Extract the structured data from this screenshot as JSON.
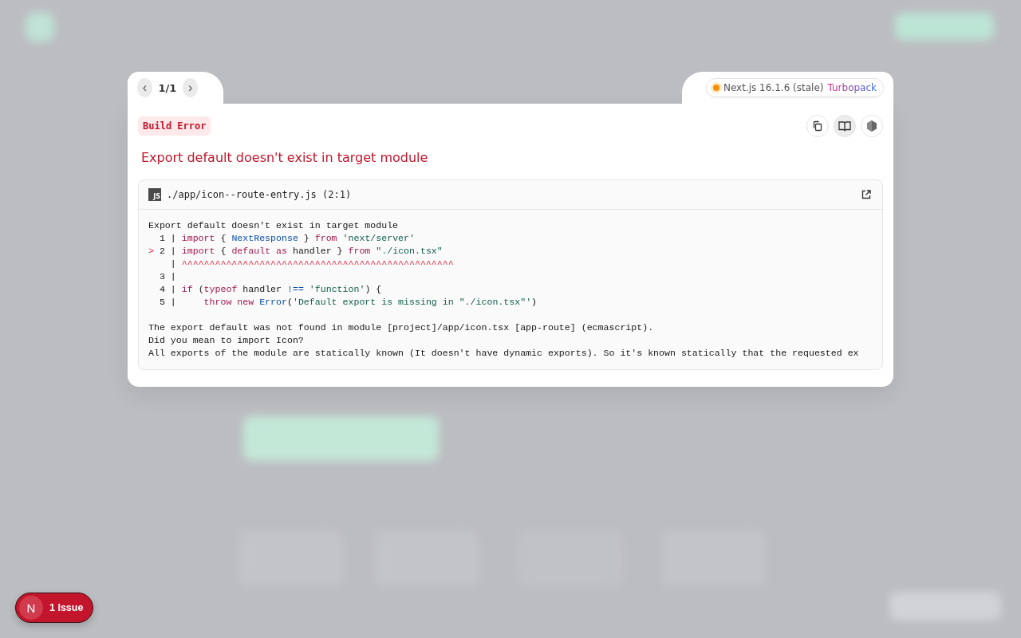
{
  "pager": {
    "prev": "‹",
    "count": "1/1",
    "next": "›"
  },
  "version": {
    "label": "Next.js 16.1.6 (stale)",
    "bundler": "Turbopack"
  },
  "error_type": "Build Error",
  "title": "Export default doesn't exist in target module",
  "file": {
    "badge": "JS",
    "path": "./app/icon--route-entry.js (2:1)"
  },
  "code_blocks": [
    [
      [
        {
          "kind": "plain",
          "text": "Export default doesn't exist in target module"
        }
      ],
      [
        {
          "kind": "plain",
          "text": "  1 | "
        },
        {
          "kind": "keyword",
          "text": "import"
        },
        {
          "kind": "plain",
          "text": " { "
        },
        {
          "kind": "ident",
          "text": "NextResponse"
        },
        {
          "kind": "plain",
          "text": " } "
        },
        {
          "kind": "keyword",
          "text": "from"
        },
        {
          "kind": "string",
          "text": " 'next/server'"
        }
      ],
      [
        {
          "kind": "marker",
          "text": ">"
        },
        {
          "kind": "plain",
          "text": " 2 | "
        },
        {
          "kind": "keyword",
          "text": "import"
        },
        {
          "kind": "plain",
          "text": " { "
        },
        {
          "kind": "keyword",
          "text": "default as"
        },
        {
          "kind": "plain",
          "text": " handler } "
        },
        {
          "kind": "keyword",
          "text": "from"
        },
        {
          "kind": "string",
          "text": " \"./icon.tsx\""
        }
      ],
      [
        {
          "kind": "plain",
          "text": "    | "
        },
        {
          "kind": "marker",
          "text": "^^^^^^^^^^^^^^^^^^^^^^^^^^^^^^^^^^^^^^^^^^^^^^^^^"
        }
      ],
      [
        {
          "kind": "plain",
          "text": "  3 |"
        }
      ],
      [
        {
          "kind": "plain",
          "text": "  4 | "
        },
        {
          "kind": "keyword",
          "text": "if"
        },
        {
          "kind": "plain",
          "text": " ("
        },
        {
          "kind": "keyword",
          "text": "typeof"
        },
        {
          "kind": "plain",
          "text": " handler "
        },
        {
          "kind": "ident",
          "text": "!=="
        },
        {
          "kind": "string",
          "text": " 'function'"
        },
        {
          "kind": "plain",
          "text": ") {"
        }
      ],
      [
        {
          "kind": "plain",
          "text": "  5 |     "
        },
        {
          "kind": "keyword",
          "text": "throw new"
        },
        {
          "kind": "ident",
          "text": " Error"
        },
        {
          "kind": "plain",
          "text": "("
        },
        {
          "kind": "string",
          "text": "'Default export is missing in \"./icon.tsx\"'"
        },
        {
          "kind": "plain",
          "text": ")"
        }
      ]
    ],
    [
      [
        {
          "kind": "plain",
          "text": "The export default was not found in module [project]/app/icon.tsx [app-route] (ecmascript)."
        }
      ],
      [
        {
          "kind": "plain",
          "text": "Did you mean to import Icon?"
        }
      ],
      [
        {
          "kind": "plain",
          "text": "All exports of the module are statically known (It doesn't have dynamic exports). So it's known statically that the requested ex"
        }
      ]
    ]
  ],
  "issues": {
    "logo": "N",
    "label": "1 Issue"
  }
}
